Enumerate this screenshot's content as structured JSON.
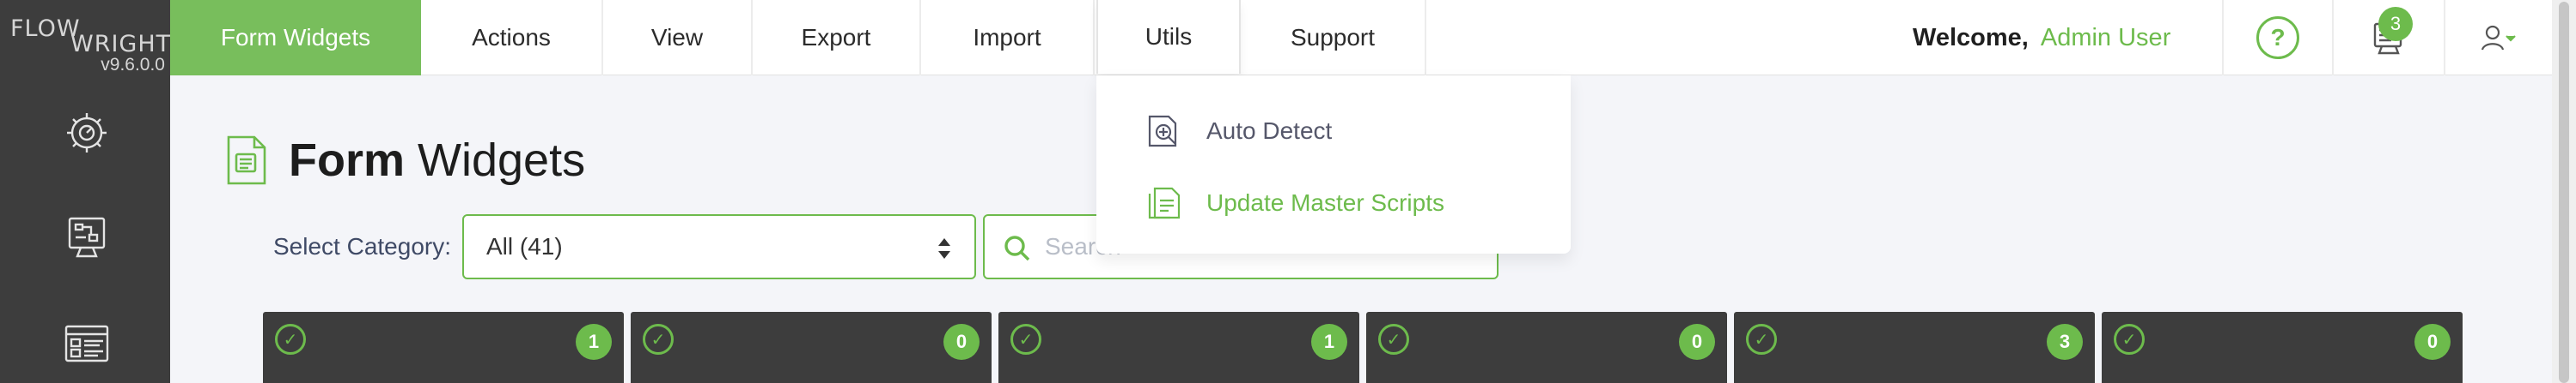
{
  "app": {
    "logo_line1": "FLOW",
    "logo_line2": "WRIGHT",
    "version": "v9.6.0.0"
  },
  "sidebar": {
    "items": [
      {
        "icon": "gear-dashboard-icon"
      },
      {
        "icon": "workflow-monitor-icon"
      },
      {
        "icon": "form-layout-icon"
      }
    ]
  },
  "nav": {
    "tabs": [
      {
        "label": "Form Widgets",
        "active": true
      },
      {
        "label": "Actions"
      },
      {
        "label": "View"
      },
      {
        "label": "Export"
      },
      {
        "label": "Import"
      },
      {
        "label": "Utils",
        "open": true
      },
      {
        "label": "Support"
      }
    ]
  },
  "header": {
    "welcome": "Welcome,",
    "user": "Admin User",
    "help_label": "?",
    "notification_count": "3"
  },
  "utils_menu": {
    "items": [
      {
        "label": "Auto Detect",
        "icon": "auto-detect-icon"
      },
      {
        "label": "Update Master Scripts",
        "icon": "update-scripts-icon"
      }
    ]
  },
  "page": {
    "title_bold": "Form",
    "title_rest": "Widgets"
  },
  "filters": {
    "category_label": "Select Category:",
    "category_value": "All (41)",
    "search_placeholder": "Search"
  },
  "cards": [
    {
      "count": "1"
    },
    {
      "count": "0"
    },
    {
      "count": "1"
    },
    {
      "count": "0"
    },
    {
      "count": "3"
    },
    {
      "count": "0"
    }
  ],
  "colors": {
    "accent": "#6dbb4c",
    "active_tab": "#78be5c",
    "sidebar": "#3d3d3d",
    "background": "#f4f5f9"
  }
}
